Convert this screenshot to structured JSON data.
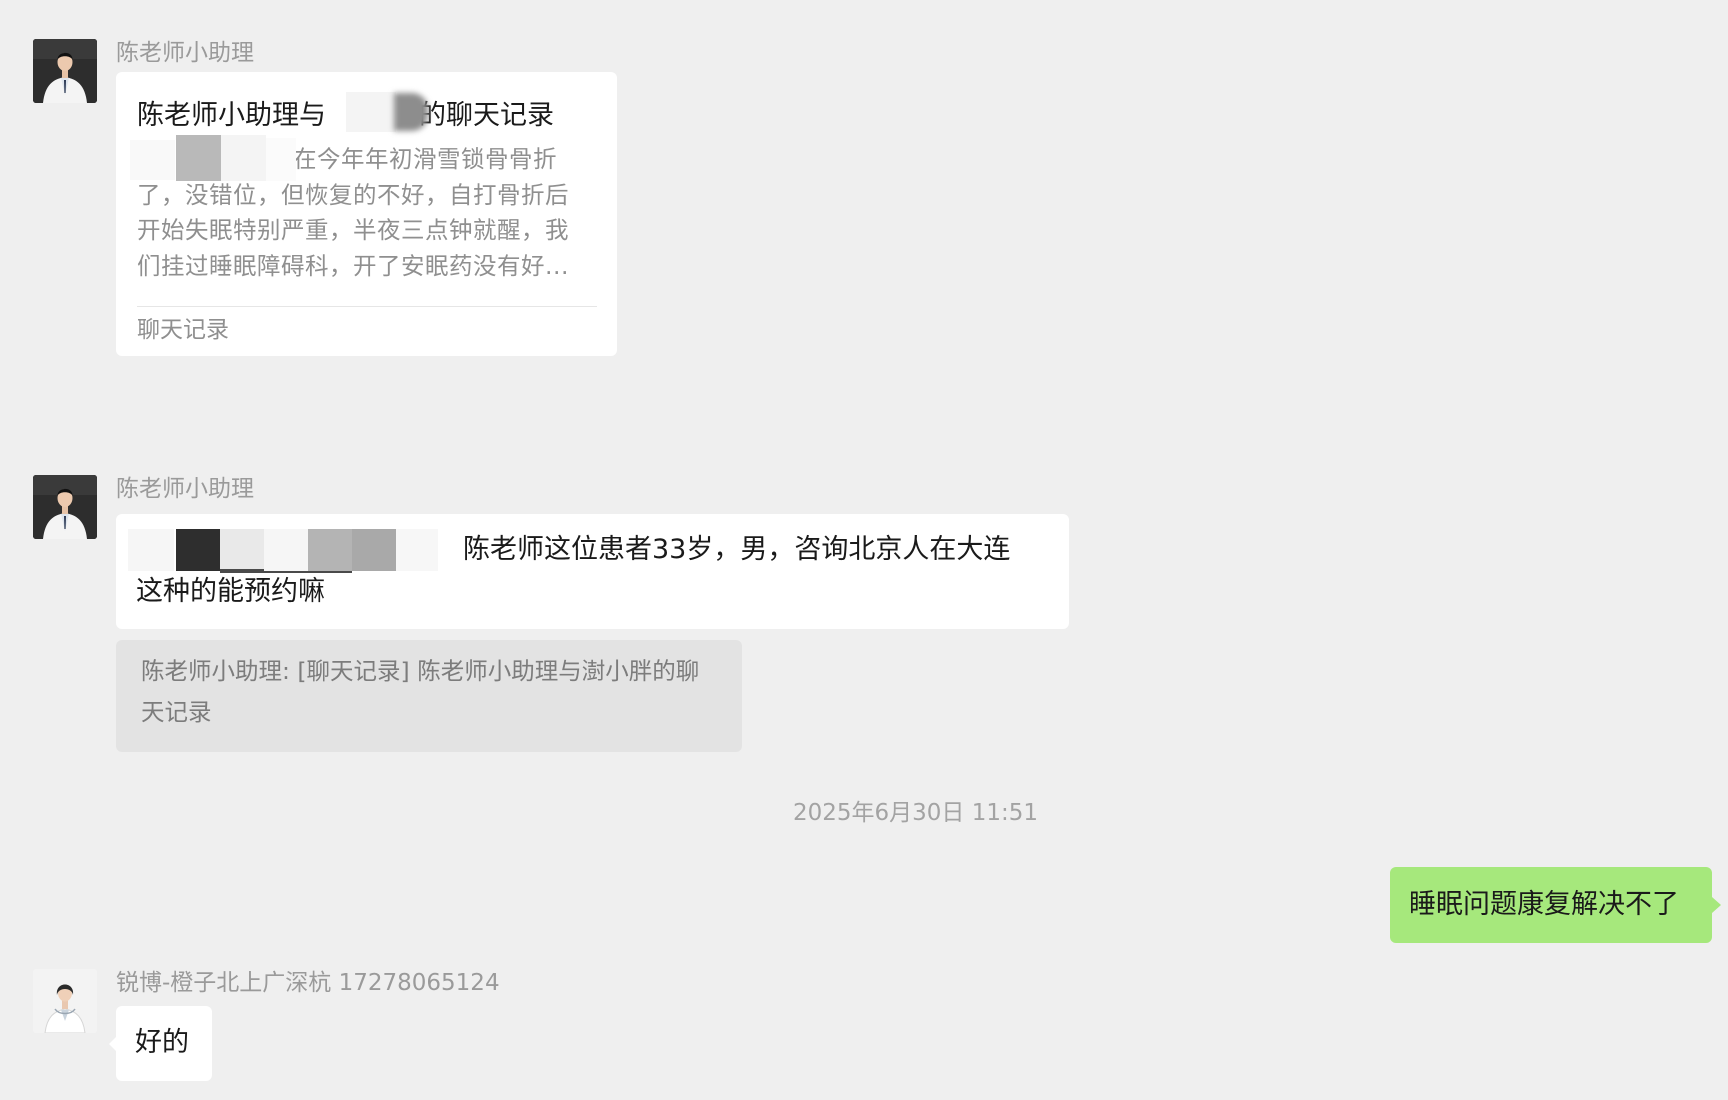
{
  "messages": [
    {
      "sender": "陈老师小助理",
      "card": {
        "title_start": "陈老师小助理与",
        "title_end": "的聊天记录",
        "preview_line1": "在今年年初滑雪锁骨骨折",
        "preview_line2": "了，没错位，但恢复的不好，自打骨折后",
        "preview_line3": "开始失眠特别严重，半夜三点钟就醒，我",
        "preview_line4": "们挂过睡眠障碍科，开了安眠药没有好...",
        "footer": "聊天记录"
      }
    },
    {
      "sender": "陈老师小助理",
      "text_line1": "陈老师这位患者33岁，男，咨询北京人在大连",
      "text_line2": "这种的能预约嘛",
      "quote_line1": "陈老师小助理: [聊天记录] 陈老师小助理与澍小胖的聊",
      "quote_line2": "天记录"
    }
  ],
  "timestamp": "2025年6月30日 11:51",
  "outgoing": {
    "text": "睡眠问题康复解决不了"
  },
  "reply": {
    "sender": "锐博-橙子北上广深杭 17278065124",
    "text": "好的"
  },
  "colors": {
    "background": "#efefef",
    "bubble_white": "#ffffff",
    "bubble_green": "#a6e87c",
    "quote_bg": "#e3e3e3"
  },
  "icons": {
    "avatar_doctor": "male-doctor-avatar",
    "avatar_reply": "female-doctor-avatar"
  }
}
